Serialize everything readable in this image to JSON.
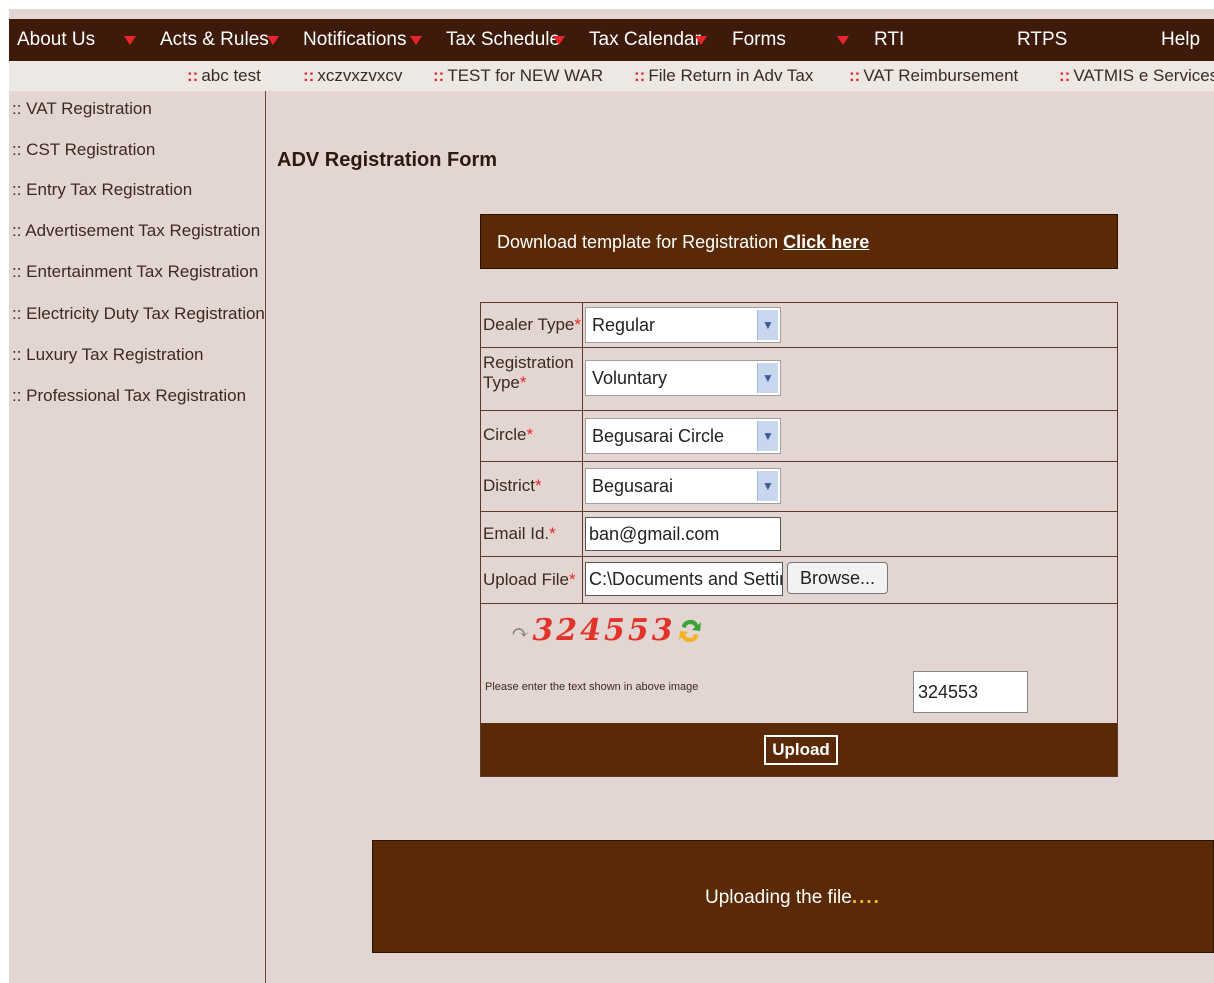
{
  "nav": {
    "items": [
      {
        "label": "About Us",
        "has_arrow": true
      },
      {
        "label": "Acts & Rules",
        "has_arrow": true
      },
      {
        "label": "Notifications",
        "has_arrow": true
      },
      {
        "label": "Tax Schedule",
        "has_arrow": true
      },
      {
        "label": "Tax Calendar",
        "has_arrow": true
      },
      {
        "label": "Forms",
        "has_arrow": true
      },
      {
        "label": "RTI",
        "has_arrow": false
      },
      {
        "label": "RTPS",
        "has_arrow": false
      },
      {
        "label": "Help",
        "has_arrow": false
      }
    ]
  },
  "subnav": {
    "prefix": "::",
    "items": [
      "abc test",
      "xczvxzvxcv",
      "TEST for NEW WAR",
      "File Return in Adv Tax",
      "VAT Reimbursement",
      "VATMIS e Services"
    ]
  },
  "sidebar": {
    "items": [
      ":: VAT Registration",
      ":: CST Registration",
      ":: Entry Tax Registration",
      ":: Advertisement Tax Registration",
      ":: Entertainment Tax Registration",
      ":: Electricity Duty Tax Registration",
      ":: Luxury Tax Registration",
      ":: Professional Tax Registration"
    ]
  },
  "page": {
    "title": "ADV Registration Form",
    "download_text": "Download template for Registration",
    "download_link": "Click here"
  },
  "form": {
    "required_mark": "*",
    "dealer_type": {
      "label": "Dealer Type",
      "value": "Regular"
    },
    "registration_type": {
      "label_line1": "Registration",
      "label_line2": "Type",
      "value": "Voluntary"
    },
    "circle": {
      "label": "Circle",
      "value": "Begusarai Circle"
    },
    "district": {
      "label": "District",
      "value": "Begusarai"
    },
    "email": {
      "label": "Email Id.",
      "value": "ban@gmail.com"
    },
    "upload_file": {
      "label": "Upload File",
      "value": "C:\\Documents and Settin",
      "browse_label": "Browse..."
    },
    "captcha": {
      "text": "324553",
      "hint": "Please enter the text shown in above image",
      "value": "324553"
    },
    "submit_label": "Upload"
  },
  "status": {
    "text": "Uploading the file",
    "dots": "...."
  },
  "colors": {
    "nav_bg": "#3d1a0a",
    "accent_brown": "#5a2a06",
    "page_bg": "#e3d5d1",
    "required_red": "#e8262a"
  }
}
